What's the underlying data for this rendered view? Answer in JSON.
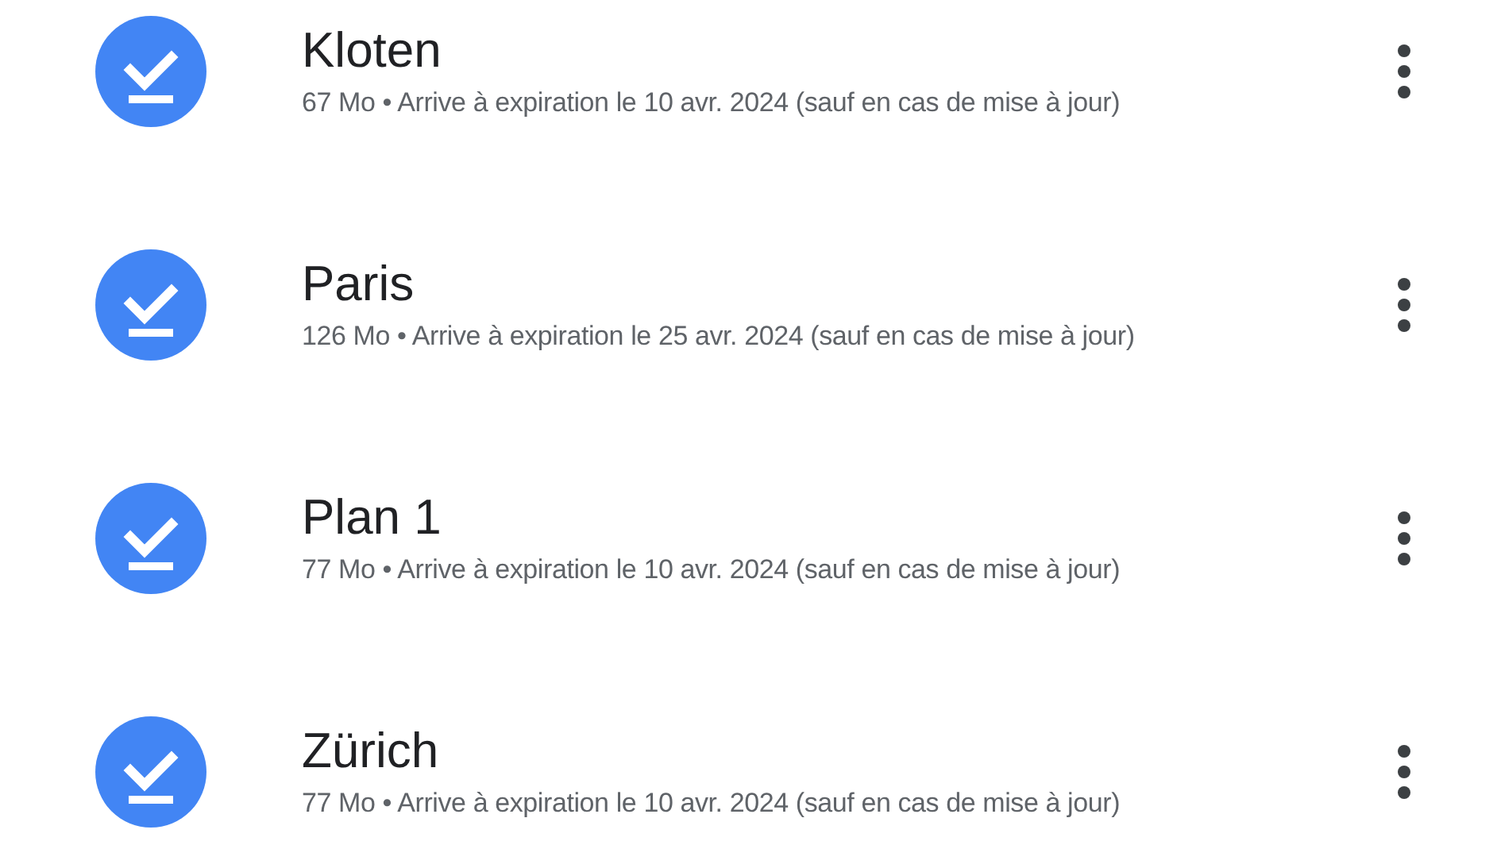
{
  "maps": [
    {
      "name": "Kloten",
      "details": "67 Mo • Arrive à expiration le 10 avr. 2024 (sauf en cas de mise à jour)"
    },
    {
      "name": "Paris",
      "details": "126 Mo • Arrive à expiration le 25 avr. 2024 (sauf en cas de mise à jour)"
    },
    {
      "name": "Plan 1",
      "details": "77 Mo • Arrive à expiration le 10 avr. 2024 (sauf en cas de mise à jour)"
    },
    {
      "name": "Zürich",
      "details": "77 Mo • Arrive à expiration le 10 avr. 2024 (sauf en cas de mise à jour)"
    }
  ]
}
